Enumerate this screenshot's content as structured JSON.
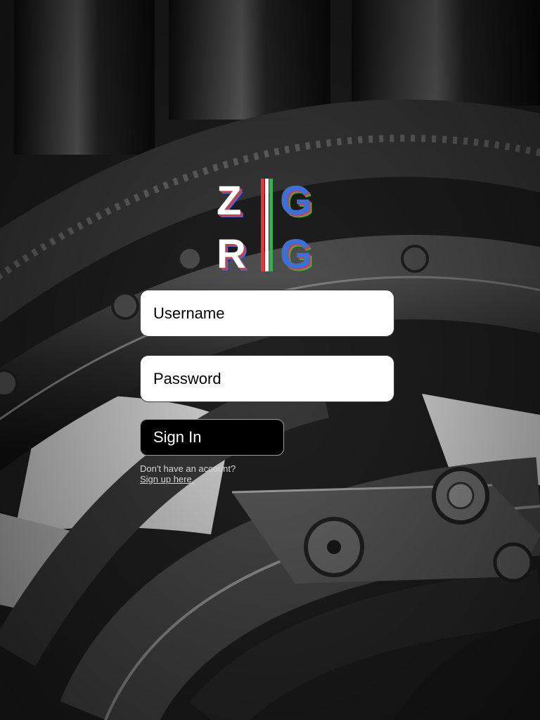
{
  "background": {
    "description_icon": "machinery-gear-photo"
  },
  "logo": {
    "row1": [
      "Z",
      "G"
    ],
    "row2": [
      "R",
      "G"
    ],
    "colors": {
      "red": "#e8333a",
      "blue": "#3b6fd9",
      "green": "#2fb34a",
      "white": "#ffffff"
    }
  },
  "form": {
    "username_placeholder": "Username",
    "password_placeholder": "Password",
    "signin_label": "Sign In",
    "no_account_text": "Don't have an account?",
    "signup_link": "Sign up here."
  }
}
